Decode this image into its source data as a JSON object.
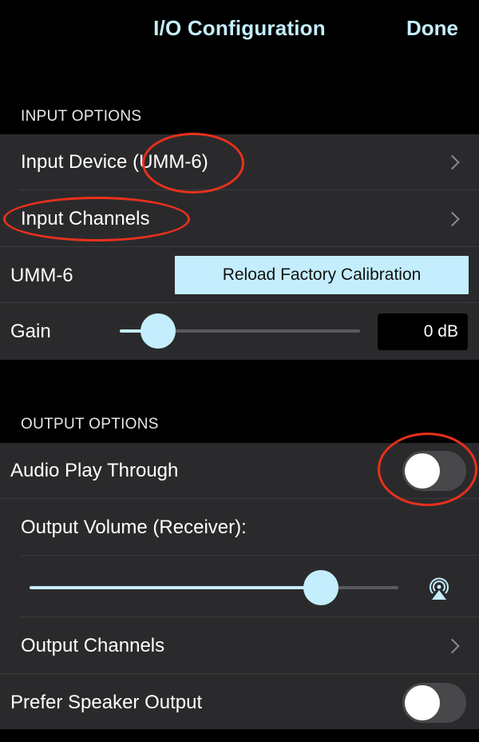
{
  "navbar": {
    "title": "I/O Configuration",
    "done_label": "Done"
  },
  "input_options": {
    "header": "INPUT OPTIONS",
    "input_device_label": "Input Device",
    "input_device_value": "(UMM-6)",
    "input_channels_label": "Input Channels",
    "umm_label": "UMM-6",
    "reload_button_label": "Reload Factory Calibration",
    "gain_label": "Gain",
    "gain_value": "0 dB",
    "gain_slider_fraction": 0.16
  },
  "output_options": {
    "header": "OUTPUT OPTIONS",
    "audio_play_through_label": "Audio Play Through",
    "audio_play_through_on": false,
    "output_volume_label": "Output Volume (Receiver):",
    "output_volume_fraction": 0.79,
    "output_channels_label": "Output Channels",
    "prefer_speaker_label": "Prefer Speaker Output",
    "prefer_speaker_on": false
  },
  "colors": {
    "accent": "#c4eefd",
    "background": "#000000",
    "group_background": "#2a2a2c",
    "annotation": "#e8301c"
  },
  "icons": [
    "chevron-right-icon",
    "airplay-icon"
  ]
}
